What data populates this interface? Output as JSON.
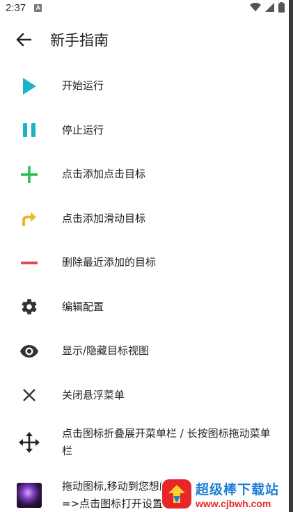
{
  "status_bar": {
    "time": "2:37",
    "notification_badge": "A",
    "icons": [
      "wifi-icon",
      "signal-icon",
      "battery-icon"
    ]
  },
  "toolbar": {
    "title": "新手指南",
    "back_icon": "arrow-left-icon"
  },
  "items": [
    {
      "icon": "play-icon",
      "color": "#1bb3c6",
      "label": "开始运行"
    },
    {
      "icon": "pause-icon",
      "color": "#1bb3c6",
      "label": "停止运行"
    },
    {
      "icon": "plus-icon",
      "color": "#2dbb4f",
      "label": "点击添加点击目标"
    },
    {
      "icon": "swipe-arrow-icon",
      "color": "#f0b429",
      "label": "点击添加滑动目标"
    },
    {
      "icon": "minus-icon",
      "color": "#e04b55",
      "label": "删除最近添加的目标"
    },
    {
      "icon": "gear-icon",
      "color": "#333333",
      "label": "编辑配置"
    },
    {
      "icon": "eye-icon",
      "color": "#333333",
      "label": "显示/隐藏目标视图"
    },
    {
      "icon": "close-icon",
      "color": "#333333",
      "label": "关闭悬浮菜单"
    },
    {
      "icon": "move-icon",
      "color": "#222222",
      "label": "点击图标折叠展开菜单栏 / 长按图标拖动菜单栏"
    },
    {
      "icon": "app-thumbnail-icon",
      "color": "#7a3dbb",
      "label": "拖动图标,移动到您想的\n=>点击图标打开设置"
    }
  ],
  "watermark": {
    "main": "超级棒下载站",
    "sub": "www.cjbwh.com"
  }
}
